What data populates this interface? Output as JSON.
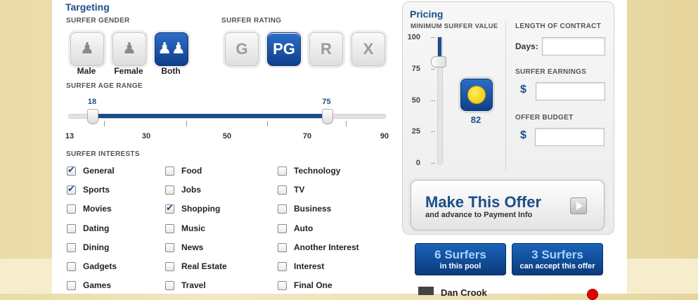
{
  "targeting": {
    "title": "Targeting",
    "gender_caption": "SURFER GENDER",
    "gender_options": [
      {
        "label": "Male",
        "icon": "male-icon",
        "selected": false
      },
      {
        "label": "Female",
        "icon": "female-icon",
        "selected": false
      },
      {
        "label": "Both",
        "icon": "both-genders-icon",
        "selected": true
      }
    ],
    "rating_caption": "SURFER RATING",
    "rating_options": [
      {
        "label": "G",
        "selected": false
      },
      {
        "label": "PG",
        "selected": true
      },
      {
        "label": "R",
        "selected": false
      },
      {
        "label": "X",
        "selected": false
      }
    ],
    "age_caption": "SURFER AGE RANGE",
    "age_min": 18,
    "age_max": 75,
    "age_ticks": [
      "13",
      "30",
      "50",
      "70",
      "90"
    ],
    "interests_caption": "SURFER INTERESTS",
    "interests": [
      [
        {
          "label": "General",
          "checked": true
        },
        {
          "label": "Sports",
          "checked": true
        },
        {
          "label": "Movies",
          "checked": false
        },
        {
          "label": "Dating",
          "checked": false
        },
        {
          "label": "Dining",
          "checked": false
        },
        {
          "label": "Gadgets",
          "checked": false
        },
        {
          "label": "Games",
          "checked": false
        }
      ],
      [
        {
          "label": "Food",
          "checked": false
        },
        {
          "label": "Jobs",
          "checked": false
        },
        {
          "label": "Shopping",
          "checked": true
        },
        {
          "label": "Music",
          "checked": false
        },
        {
          "label": "News",
          "checked": false
        },
        {
          "label": "Real Estate",
          "checked": false
        },
        {
          "label": "Travel",
          "checked": false
        }
      ],
      [
        {
          "label": "Technology",
          "checked": false
        },
        {
          "label": "TV",
          "checked": false
        },
        {
          "label": "Business",
          "checked": false
        },
        {
          "label": "Auto",
          "checked": false
        },
        {
          "label": "Another Interest",
          "checked": false
        },
        {
          "label": "Interest",
          "checked": false
        },
        {
          "label": "Final One",
          "checked": false
        }
      ]
    ]
  },
  "pricing": {
    "title": "Pricing",
    "min_value_caption": "MINIMUM SURFER VALUE",
    "scale_labels": [
      "100",
      "75",
      "50",
      "25",
      "0"
    ],
    "min_value": 82,
    "contract_caption": "LENGTH OF CONTRACT",
    "days_label": "Days:",
    "days_value": "",
    "earnings_caption": "SURFER EARNINGS",
    "earnings_currency": "$",
    "earnings_value": "",
    "budget_caption": "OFFER BUDGET",
    "budget_currency": "$",
    "budget_value": ""
  },
  "offer_button": {
    "title": "Make This Offer",
    "subtitle": "and advance to Payment Info"
  },
  "stats": [
    {
      "count": "6 Surfers",
      "label": "in this pool"
    },
    {
      "count": "3 Surfers",
      "label": "can accept this offer"
    }
  ],
  "surfer_list": [
    {
      "name": "Dan Crook",
      "status_color": "#e00000"
    }
  ],
  "colors": {
    "accent": "#1b4e8a",
    "button_blue": "#0f3f8c"
  }
}
